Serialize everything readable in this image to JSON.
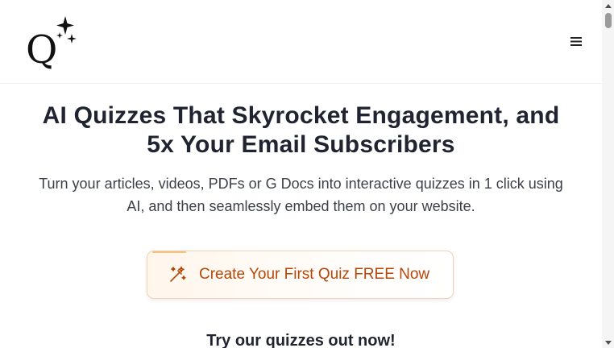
{
  "header": {
    "logo_icon": "q-sparkle-logo",
    "menu_icon": "hamburger-menu-icon"
  },
  "hero": {
    "title_line1": "AI Quizzes That Skyrocket Engagement, and",
    "title_line2": "5x Your Email Subscribers",
    "subtitle_line1": "Turn your articles, videos, PDFs or G Docs into interactive quizzes in 1 click using",
    "subtitle_line2": "AI, and then seamlessly embed them on your website."
  },
  "cta": {
    "label": "Create Your First Quiz FREE Now",
    "icon": "magic-wand-icon",
    "text_color": "#b54708"
  },
  "try_section": {
    "heading": "Try our quizzes out now!"
  },
  "colors": {
    "title": "#1f2430",
    "body_text": "#3b3f47",
    "accent": "#b54708"
  }
}
